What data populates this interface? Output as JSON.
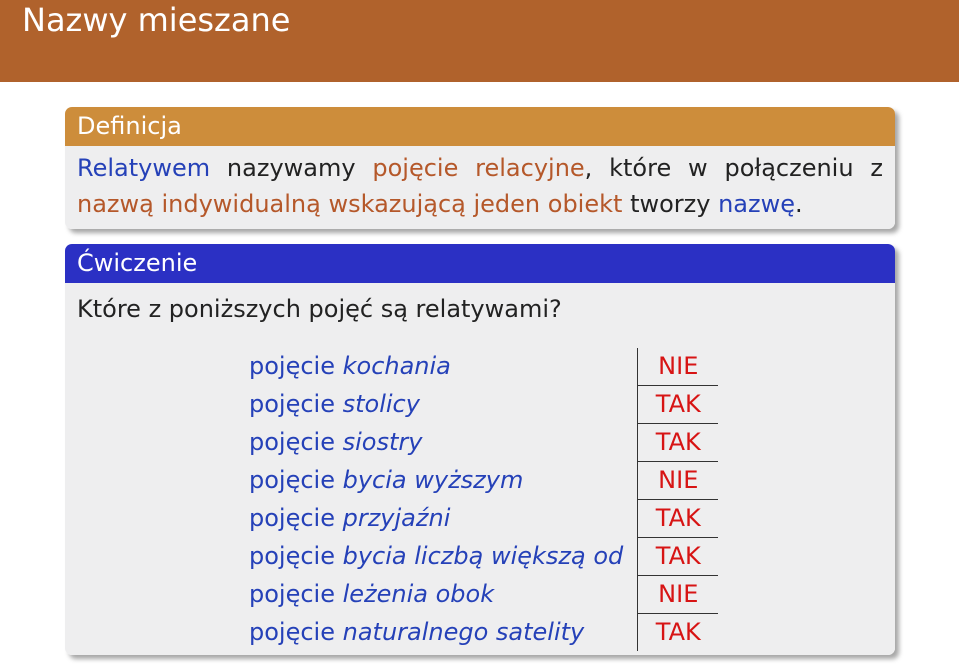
{
  "title": "Nazwy mieszane",
  "definition": {
    "heading": "Definicja",
    "line1": [
      {
        "text": "Relatywem",
        "style": "term"
      },
      {
        "text": "nazywamy",
        "style": "plain"
      },
      {
        "text": "pojęcie",
        "style": "hl"
      },
      {
        "text": "relacyjne,",
        "style": "mixed_hl_comma"
      },
      {
        "text": "które",
        "style": "plain"
      },
      {
        "text": "w",
        "style": "plain"
      },
      {
        "text": "połączeniu",
        "style": "plain"
      },
      {
        "text": "z",
        "style": "plain"
      }
    ],
    "line2_parts": {
      "a": "nazwą indywidualną wskazującą jeden obiekt",
      "b": " tworzy ",
      "c": "nazwę",
      "d": "."
    }
  },
  "exercise": {
    "heading": "Ćwiczenie",
    "question": "Które z poniższych pojęć są relatywami?",
    "rows": [
      {
        "prefix": "pojęcie ",
        "term": "kochania",
        "answer": "NIE"
      },
      {
        "prefix": "pojęcie ",
        "term": "stolicy",
        "answer": "TAK"
      },
      {
        "prefix": "pojęcie ",
        "term": "siostry",
        "answer": "TAK"
      },
      {
        "prefix": "pojęcie ",
        "term": "bycia wyższym",
        "answer": "NIE"
      },
      {
        "prefix": "pojęcie ",
        "term": "przyjaźni",
        "answer": "TAK"
      },
      {
        "prefix": "pojęcie ",
        "term": "bycia liczbą większą od",
        "answer": "TAK"
      },
      {
        "prefix": "pojęcie ",
        "term": "leżenia obok",
        "answer": "NIE"
      },
      {
        "prefix": "pojęcie ",
        "term": "naturalnego satelity",
        "answer": "TAK"
      }
    ]
  },
  "colors": {
    "title_bar": "#b0622c",
    "definition_header": "#cd8d3b",
    "exercise_header": "#2b30c4",
    "term_blue": "#2541b8",
    "highlight_orange": "#b5582a",
    "answer_red": "#d71414"
  }
}
